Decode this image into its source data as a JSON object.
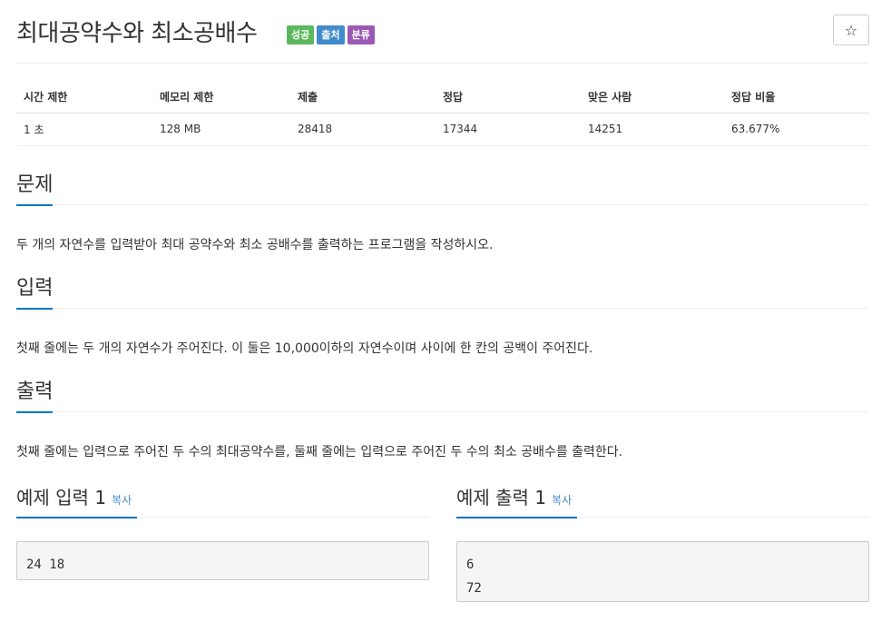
{
  "header": {
    "title": "최대공약수와 최소공배수",
    "badges": [
      "성공",
      "출처",
      "분류"
    ],
    "star": "☆"
  },
  "info_table": {
    "headers": [
      "시간 제한",
      "메모리 제한",
      "제출",
      "정답",
      "맞은 사람",
      "정답 비율"
    ],
    "row": [
      "1 초",
      "128 MB",
      "28418",
      "17344",
      "14251",
      "63.677%"
    ]
  },
  "problem": {
    "title": "문제",
    "text": "두 개의 자연수를 입력받아 최대 공약수와 최소 공배수를 출력하는 프로그램을 작성하시오."
  },
  "input": {
    "title": "입력",
    "text": "첫째 줄에는 두 개의 자연수가 주어진다. 이 둘은 10,000이하의 자연수이며 사이에 한 칸의 공백이 주어진다."
  },
  "output": {
    "title": "출력",
    "text": "첫째 줄에는 입력으로 주어진 두 수의 최대공약수를, 둘째 줄에는 입력으로 주어진 두 수의 최소 공배수를 출력한다."
  },
  "sample_input": {
    "title": "예제 입력 1",
    "copy": "복사",
    "content": "24 18"
  },
  "sample_output": {
    "title": "예제 출력 1",
    "copy": "복사",
    "content": "6\n72"
  }
}
